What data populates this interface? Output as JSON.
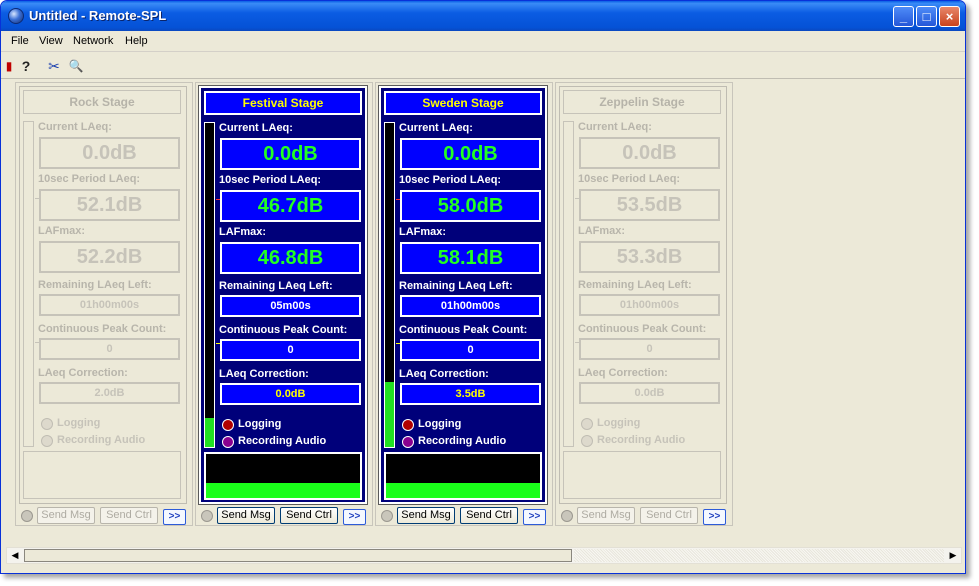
{
  "window": {
    "title": "Untitled - Remote-SPL",
    "minimize_glyph": "_",
    "maximize_glyph": "□",
    "close_glyph": "×"
  },
  "menu": [
    "File",
    "View",
    "Network",
    "Help"
  ],
  "toolbar": {
    "icons": [
      "meter-icon",
      "help-question-icon",
      "tools-icon",
      "search-magnifier-icon"
    ],
    "glyphs": [
      "▮",
      "?",
      "✂",
      "🔍"
    ]
  },
  "labels": {
    "current_laeq": "Current LAeq:",
    "period_laeq": "10sec Period LAeq:",
    "lafmax": "LAFmax:",
    "remaining": "Remaining LAeq Left:",
    "peak_count": "Continuous Peak Count:",
    "correction": "LAeq Correction:",
    "logging": "Logging",
    "recording": "Recording Audio",
    "send_msg": "Send Msg",
    "send_ctrl": "Send Ctrl",
    "more": ">>"
  },
  "stages": [
    {
      "name": "Rock Stage",
      "active": false,
      "current_laeq": "0.0dB",
      "period_laeq": "52.1dB",
      "lafmax": "52.2dB",
      "remaining": "01h00m00s",
      "peak_count": "0",
      "correction": "2.0dB",
      "meter_level": 0
    },
    {
      "name": "Festival Stage",
      "active": true,
      "current_laeq": "0.0dB",
      "period_laeq": "46.7dB",
      "lafmax": "46.8dB",
      "remaining": "05m00s",
      "peak_count": "0",
      "correction": "0.0dB",
      "meter_level": 0.09
    },
    {
      "name": "Sweden Stage",
      "active": true,
      "current_laeq": "0.0dB",
      "period_laeq": "58.0dB",
      "lafmax": "58.1dB",
      "remaining": "01h00m00s",
      "peak_count": "0",
      "correction": "3.5dB",
      "meter_level": 0.2
    },
    {
      "name": "Zeppelin Stage",
      "active": false,
      "current_laeq": "0.0dB",
      "period_laeq": "53.5dB",
      "lafmax": "53.3dB",
      "remaining": "01h00m00s",
      "peak_count": "0",
      "correction": "0.0dB",
      "meter_level": 0
    }
  ],
  "colors": {
    "panel_bg": "#00007a",
    "value_bg": "#0000ff",
    "value_text": "#22ff22",
    "title_text": "#ffff00",
    "meter_green": "#22e022"
  }
}
